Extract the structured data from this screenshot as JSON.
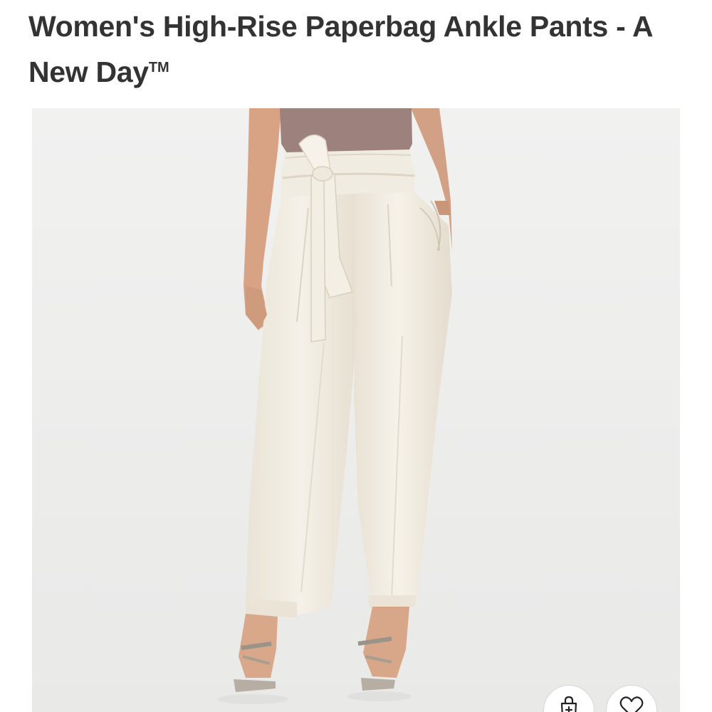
{
  "product": {
    "title": "Women's High-Rise Paperbag Ankle Pants - A New Day",
    "trademark": "TM",
    "image_alt": "Women's High-Rise Paperbag Ankle Pants - A New Day"
  },
  "actions": {
    "add_to_cart_icon": "shopping-bag-icon",
    "favorite_icon": "heart-icon"
  },
  "colors": {
    "title_text": "#333333",
    "image_background": "#efefee",
    "pants": "#f2ede2",
    "top": "#9a7f7a",
    "skin": "#d9a88a"
  }
}
